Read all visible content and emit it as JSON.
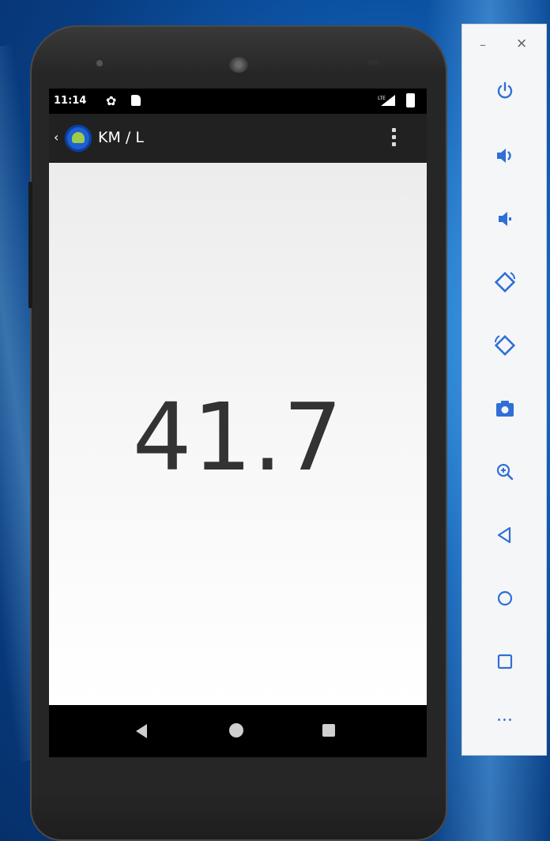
{
  "status_bar": {
    "time": "11:14"
  },
  "app_bar": {
    "title": "KM / L"
  },
  "content": {
    "result": "41.7"
  },
  "toolbar": {
    "minimize_glyph": "–",
    "close_glyph": "×",
    "more_glyph": "•••",
    "buttons": [
      {
        "name": "power-icon",
        "label": "Power"
      },
      {
        "name": "volume-up-icon",
        "label": "Volume up"
      },
      {
        "name": "volume-down-icon",
        "label": "Volume down"
      },
      {
        "name": "rotate-left-icon",
        "label": "Rotate left"
      },
      {
        "name": "rotate-right-icon",
        "label": "Rotate right"
      },
      {
        "name": "camera-icon",
        "label": "Take screenshot"
      },
      {
        "name": "zoom-icon",
        "label": "Zoom"
      },
      {
        "name": "back-icon",
        "label": "Back"
      },
      {
        "name": "home-icon",
        "label": "Home"
      },
      {
        "name": "overview-icon",
        "label": "Overview"
      },
      {
        "name": "more-icon",
        "label": "More"
      }
    ]
  },
  "colors": {
    "app_bar": "#212121",
    "accent_icon": "#1e5fd6",
    "toolbar_icon": "#2f6fd6"
  }
}
